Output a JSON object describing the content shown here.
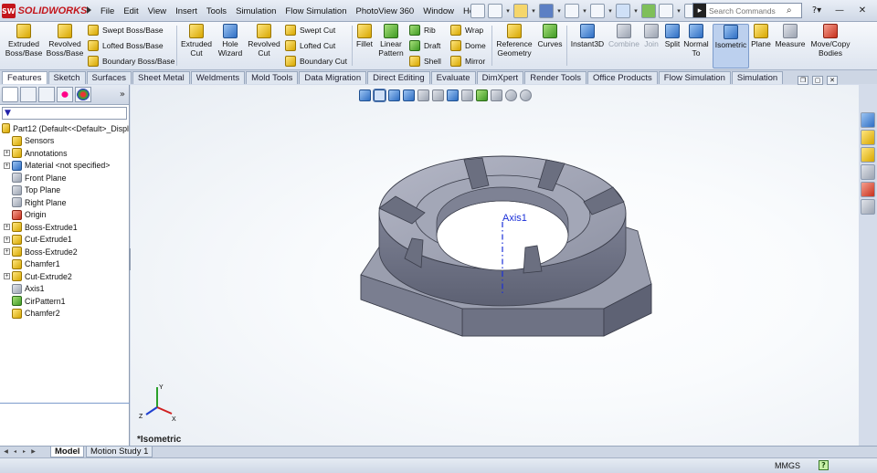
{
  "app": {
    "name": "SOLIDWORKS",
    "logo_badge": "SW"
  },
  "menu": [
    "File",
    "Edit",
    "View",
    "Insert",
    "Tools",
    "Simulation",
    "Flow Simulation",
    "PhotoView 360",
    "Window",
    "Help"
  ],
  "search": {
    "placeholder": "Search Commands"
  },
  "ribbon": {
    "extruded_boss": "Extruded\nBoss/Base",
    "revolved_boss": "Revolved\nBoss/Base",
    "swept_boss": "Swept Boss/Base",
    "lofted_boss": "Lofted Boss/Base",
    "boundary_boss": "Boundary Boss/Base",
    "extruded_cut": "Extruded\nCut",
    "hole_wizard": "Hole\nWizard",
    "revolved_cut": "Revolved\nCut",
    "swept_cut": "Swept Cut",
    "lofted_cut": "Lofted Cut",
    "boundary_cut": "Boundary Cut",
    "fillet": "Fillet",
    "linear_pattern": "Linear\nPattern",
    "rib": "Rib",
    "draft": "Draft",
    "shell": "Shell",
    "wrap": "Wrap",
    "dome": "Dome",
    "mirror": "Mirror",
    "reference_geometry": "Reference\nGeometry",
    "curves": "Curves",
    "instant3d": "Instant3D",
    "combine": "Combine",
    "join": "Join",
    "split": "Split",
    "normal_to": "Normal\nTo",
    "isometric": "Isometric",
    "plane": "Plane",
    "measure": "Measure",
    "move_copy": "Move/Copy\nBodies"
  },
  "tabs": [
    "Features",
    "Sketch",
    "Surfaces",
    "Sheet Metal",
    "Weldments",
    "Mold Tools",
    "Data Migration",
    "Direct Editing",
    "Evaluate",
    "DimXpert",
    "Render Tools",
    "Office Products",
    "Flow Simulation",
    "Simulation"
  ],
  "active_tab": "Features",
  "tree": {
    "root": "Part12  (Default<<Default>_Displ",
    "items": [
      {
        "label": "Sensors",
        "icon": "sensor-icon",
        "exp": false
      },
      {
        "label": "Annotations",
        "icon": "annotation-icon",
        "exp": true
      },
      {
        "label": "Material <not specified>",
        "icon": "material-icon",
        "exp": true
      },
      {
        "label": "Front Plane",
        "icon": "plane-icon",
        "exp": false
      },
      {
        "label": "Top Plane",
        "icon": "plane-icon",
        "exp": false
      },
      {
        "label": "Right Plane",
        "icon": "plane-icon",
        "exp": false
      },
      {
        "label": "Origin",
        "icon": "origin-icon",
        "exp": false
      },
      {
        "label": "Boss-Extrude1",
        "icon": "extrude-icon",
        "exp": true
      },
      {
        "label": "Cut-Extrude1",
        "icon": "cut-icon",
        "exp": true
      },
      {
        "label": "Boss-Extrude2",
        "icon": "extrude-icon",
        "exp": true
      },
      {
        "label": "Chamfer1",
        "icon": "chamfer-icon",
        "exp": false
      },
      {
        "label": "Cut-Extrude2",
        "icon": "cut-icon",
        "exp": true
      },
      {
        "label": "Axis1",
        "icon": "axis-icon",
        "exp": false
      },
      {
        "label": "CirPattern1",
        "icon": "pattern-icon",
        "exp": false
      },
      {
        "label": "Chamfer2",
        "icon": "chamfer-icon",
        "exp": false
      }
    ]
  },
  "viewport": {
    "axis_label": "Axis1",
    "view_name": "*Isometric"
  },
  "triad": {
    "x": "X",
    "y": "Y",
    "z": "Z"
  },
  "bottom_tabs": [
    "Model",
    "Motion Study 1"
  ],
  "status": {
    "units": "MMGS",
    "help": "?"
  },
  "colors": {
    "accent": "#c3161c",
    "part": "#8f93a4",
    "axis": "#1a2fd8"
  }
}
